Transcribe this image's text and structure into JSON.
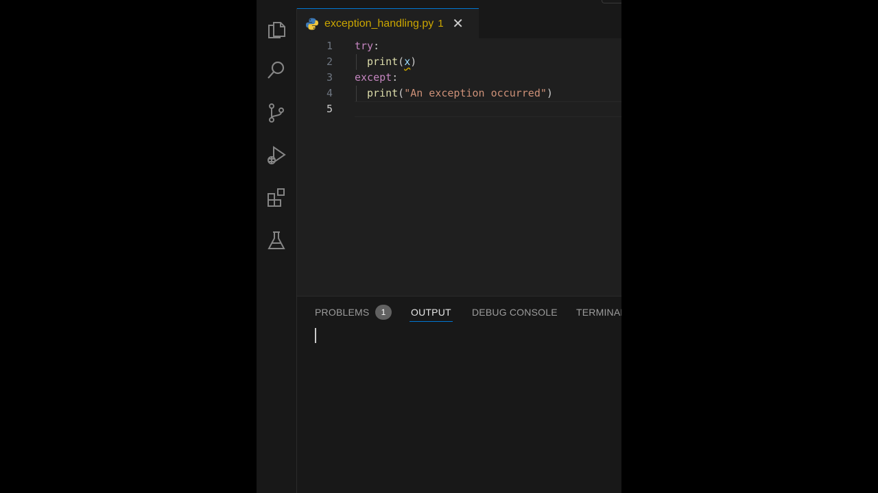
{
  "tab": {
    "filename": "exception_handling.py",
    "problem_count": "1",
    "close_glyph": "✕",
    "file_color": "#cca700"
  },
  "editor": {
    "lines": [
      {
        "number": "1",
        "text": "try:"
      },
      {
        "number": "2",
        "text": "print(x)"
      },
      {
        "number": "3",
        "text": "except:"
      },
      {
        "number": "4",
        "text": "print(\"An exception occurred\")"
      },
      {
        "number": "5",
        "text": ""
      }
    ],
    "tokens": {
      "l1_kw": "try",
      "l1_colon": ":",
      "l2_fn": "print",
      "l2_open": "(",
      "l2_var": "x",
      "l2_close": ")",
      "l3_kw": "except",
      "l3_colon": ":",
      "l4_fn": "print",
      "l4_open": "(",
      "l4_str": "\"An exception occurred\"",
      "l4_close": ")"
    }
  },
  "activity_bar": {
    "icons": [
      "explorer-icon",
      "search-icon",
      "source-control-icon",
      "run-debug-icon",
      "extensions-icon",
      "testing-icon"
    ]
  },
  "panel": {
    "tabs": {
      "problems": "PROBLEMS",
      "problems_badge": "1",
      "output": "OUTPUT",
      "debug_console": "DEBUG CONSOLE",
      "terminal": "TERMINAL"
    },
    "active_tab": "OUTPUT"
  },
  "colors": {
    "accent": "#0078d4",
    "keyword": "#c586c0",
    "function": "#dcdcaa",
    "string": "#ce9178",
    "variable": "#9cdcfe",
    "warning": "#cca700"
  }
}
